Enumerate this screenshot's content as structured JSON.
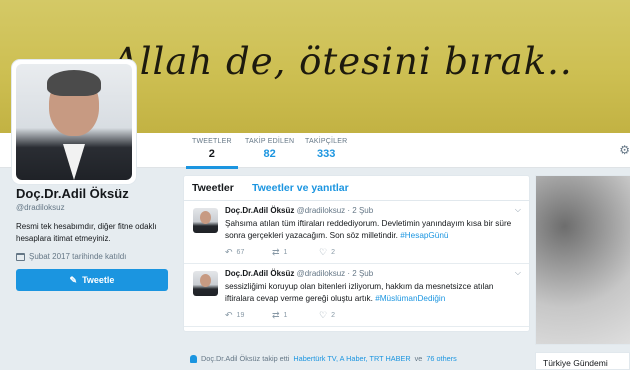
{
  "banner": {
    "text": "Allah de, ötesini bırak.."
  },
  "nav": {
    "stats": [
      {
        "label": "TWEETLER",
        "value": "2"
      },
      {
        "label": "TAKİP EDİLEN",
        "value": "82"
      },
      {
        "label": "TAKİPÇİLER",
        "value": "333"
      }
    ],
    "settings_icon": "gear-icon"
  },
  "profile": {
    "name": "Doç.Dr.Adil Öksüz",
    "handle": "@dradiloksuz",
    "bio": "Resmi tek hesabımdır, diğer fitne odaklı hesaplara itimat etmeyiniz.",
    "joined": "Şubat 2017 tarihinde katıldı",
    "tweet_button": "Tweetle"
  },
  "timeline": {
    "tabs": [
      "Tweetler",
      "Tweetler ve yanıtlar"
    ],
    "tweets": [
      {
        "name": "Doç.Dr.Adil Öksüz",
        "meta": "@dradiloksuz · 2 Şub",
        "text": "Şahsıma atılan tüm iftiraları reddediyorum. Devletimin yanındayım kısa bir süre sonra gerçekleri yazacağım. Son söz milletindir.",
        "hashtag": "#HesapGünü",
        "replies": "",
        "retweets": "67",
        "likes": "1",
        "hearts": "2"
      },
      {
        "name": "Doç.Dr.Adil Öksüz",
        "meta": "@dradiloksuz · 2 Şub",
        "text": "sessizliğimi koruyup olan bitenleri izliyorum, hakkım da mesnetsizce atılan iftiralara cevap verme gereği oluştu artık.",
        "hashtag": "#MüslümanDediğin",
        "replies": "",
        "retweets": "19",
        "likes": "1",
        "hearts": "2"
      }
    ]
  },
  "follow_line": {
    "prefix": "Doç.Dr.Adil Öksüz takip etti",
    "links": "Habertürk TV, A Haber, TRT HABER",
    "suffix": "ve",
    "others": "76 others"
  },
  "sidebar": {
    "trends_title": "Türkiye Gündemi"
  },
  "colors": {
    "accent": "#1b95e0",
    "banner": "#cdbf52",
    "background": "#e6ecf0"
  }
}
